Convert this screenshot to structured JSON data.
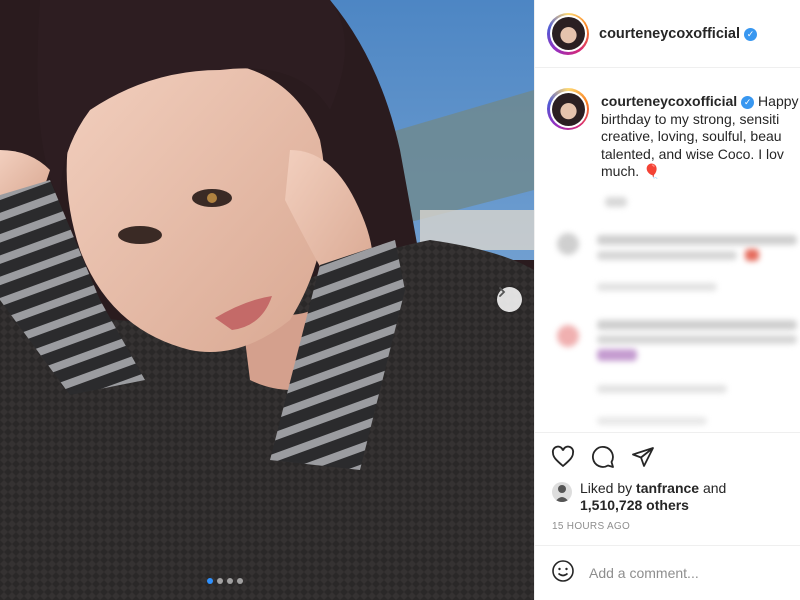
{
  "post": {
    "username": "courteneycoxofficial",
    "verified_mark": "✓",
    "carousel": {
      "dot_count": 4,
      "active_dot_index": 0,
      "next_icon": "chevron-right-icon"
    }
  },
  "caption": {
    "username": "courteneycoxofficial",
    "lines": [
      "Happy",
      "birthday to my strong, sensiti",
      "creative, loving, soulful, beau",
      "talented, and wise Coco. I lov",
      "much."
    ],
    "emoji": "🎈"
  },
  "actions": {
    "icons": [
      "heart-icon",
      "comment-icon",
      "share-icon"
    ]
  },
  "likes": {
    "prefix": "Liked by",
    "user": "tanfrance",
    "connector": "and",
    "others": "1,510,728 others"
  },
  "timestamp": "15 HOURS AGO",
  "comment": {
    "placeholder": "Add a comment...",
    "emoji_icon": "smiley-icon"
  },
  "colors": {
    "accent": "#3897f0",
    "muted": "#8e8e8e",
    "border": "#efefef",
    "active_dot": "#2f91ff"
  }
}
